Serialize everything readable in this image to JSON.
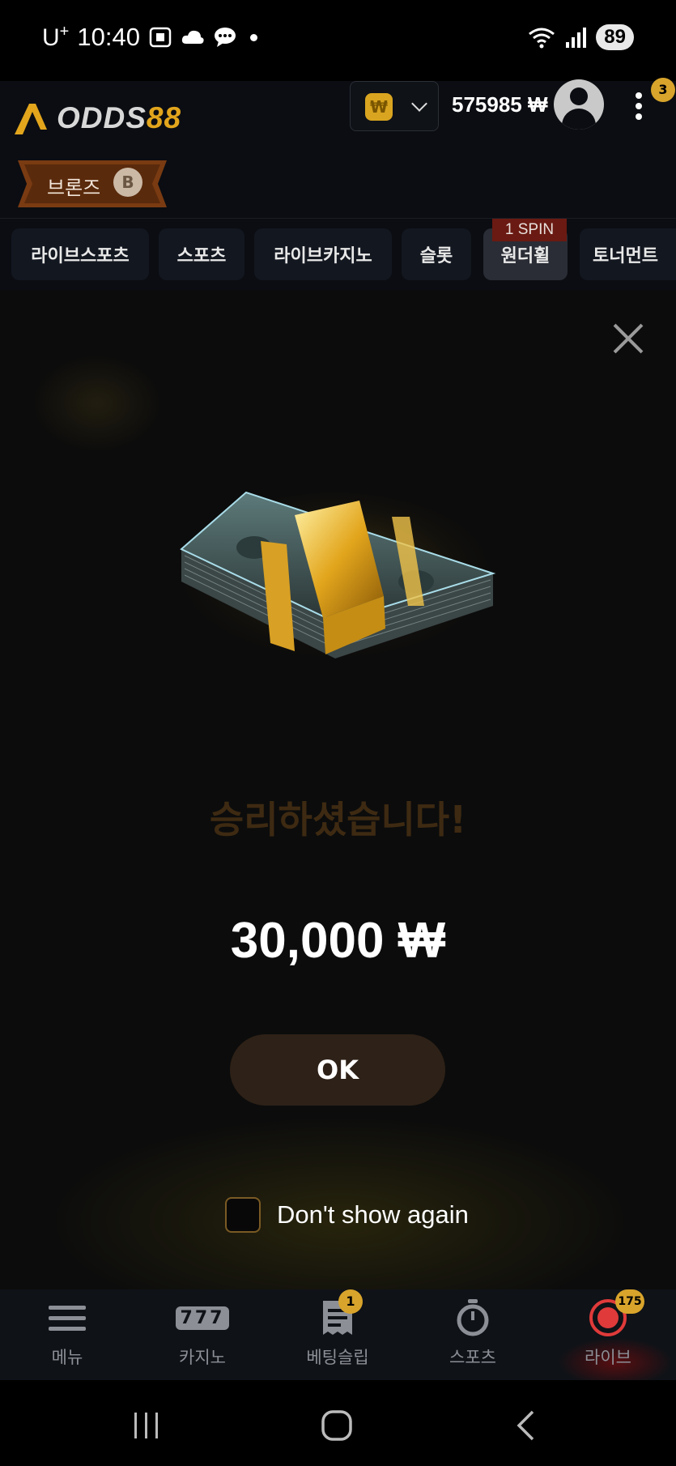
{
  "status_bar": {
    "carrier": "U",
    "carrier_sup": "+",
    "time": "10:40",
    "battery": "89"
  },
  "header": {
    "logo_odds": "ODDS",
    "logo_num": "88",
    "currency_symbol": "₩",
    "balance": "575985 ₩",
    "notification_count": "3"
  },
  "rank": {
    "label": "브론즈",
    "coin_letter": "B"
  },
  "tabs": [
    {
      "label": "라이브스포츠"
    },
    {
      "label": "스포츠"
    },
    {
      "label": "라이브카지노"
    },
    {
      "label": "슬롯"
    },
    {
      "label": "원더휠",
      "badge": "1 SPIN",
      "active": true
    },
    {
      "label": "토너먼트"
    }
  ],
  "popup": {
    "title": "승리하셨습니다!",
    "amount": "30,000 ₩",
    "ok_label": "OK",
    "dont_show_label": "Don't show again"
  },
  "bottom_nav": [
    {
      "label": "메뉴",
      "icon": "menu-icon"
    },
    {
      "label": "카지노",
      "icon": "slot-777-icon",
      "glyph": "777"
    },
    {
      "label": "베팅슬립",
      "icon": "receipt-icon",
      "badge": "1"
    },
    {
      "label": "스포츠",
      "icon": "stopwatch-icon"
    },
    {
      "label": "라이브",
      "icon": "live-record-icon",
      "badge": "175"
    }
  ],
  "colors": {
    "accent_gold": "#d8a42b",
    "rank_bronze": "#7a3b12",
    "win_title": "#3e2a12",
    "ok_button": "#2e2117"
  }
}
